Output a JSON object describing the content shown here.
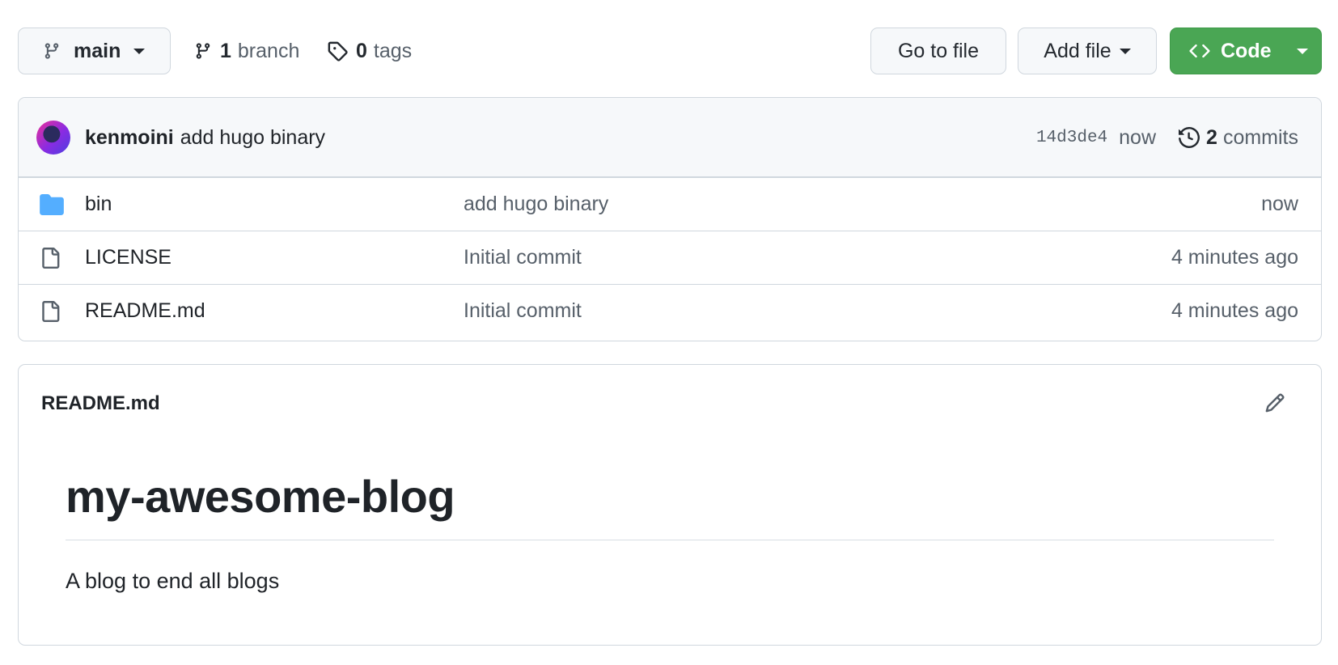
{
  "toolbar": {
    "branch_selector": "main",
    "branch_count": "1",
    "branch_label": "branch",
    "tag_count": "0",
    "tag_label": "tags",
    "go_to_file": "Go to file",
    "add_file": "Add file",
    "code": "Code"
  },
  "latest_commit": {
    "author": "kenmoini",
    "message": "add hugo binary",
    "sha": "14d3de4",
    "time": "now",
    "commit_count": "2",
    "commit_label": "commits"
  },
  "files": [
    {
      "name": "bin",
      "type": "folder",
      "message": "add hugo binary",
      "time": "now"
    },
    {
      "name": "LICENSE",
      "type": "file",
      "message": "Initial commit",
      "time": "4 minutes ago"
    },
    {
      "name": "README.md",
      "type": "file",
      "message": "Initial commit",
      "time": "4 minutes ago"
    }
  ],
  "readme": {
    "filename": "README.md",
    "heading": "my-awesome-blog",
    "body": "A blog to end all blogs"
  },
  "colors": {
    "code_button": "#4aa654",
    "folder_icon": "#54aeff",
    "header_bg": "#f6f8fa",
    "border": "#d0d7de"
  },
  "icons": {
    "branch": "git-branch-icon",
    "tag": "tag-icon",
    "code": "code-icon",
    "history": "history-icon",
    "folder": "folder-icon",
    "file": "file-icon",
    "edit": "pencil-icon"
  }
}
